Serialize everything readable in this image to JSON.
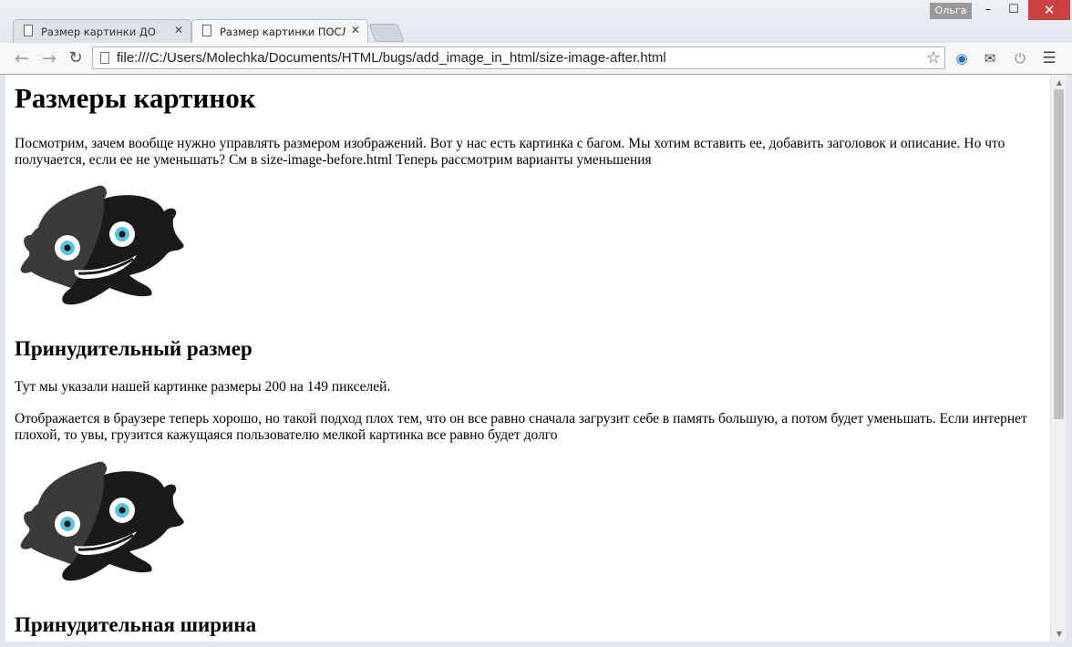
{
  "window": {
    "user_name": "Ольга",
    "minimize_glyph": "–",
    "maximize_glyph": "☐",
    "close_glyph": "✕"
  },
  "tabs": [
    {
      "label": "Размер картинки ДО",
      "close": "✕",
      "active": false
    },
    {
      "label": "Размер картинки ПОСЛЕ",
      "close": "✕",
      "active": true
    }
  ],
  "toolbar": {
    "back_glyph": "←",
    "forward_glyph": "→",
    "reload_glyph": "↻",
    "url": "file:///C:/Users/Molechka/Documents/HTML/bugs/add_image_in_html/size-image-after.html",
    "bookmark_glyph": "☆",
    "icons": [
      "globe-icon",
      "mail-icon",
      "power-icon",
      "menu-icon"
    ]
  },
  "page": {
    "heading": "Размеры картинок",
    "intro": "Посмотрим, зачем вообще нужно управлять размером изображений. Вот у нас есть картинка с багом. Мы хотим вставить ее, добавить заголовок и описание. Но что получается, если ее не уменьшать? См в size-image-before.html Теперь рассмотрим варианты уменьшения",
    "section1_heading": "Принудительный размер",
    "section1_p1": "Тут мы указали нашей картинке размеры 200 на 149 пикселей.",
    "section1_p2": "Отображается в браузере теперь хорошо, но такой подход плох тем, что он все равно сначала загрузит себе в память большую, а потом будет уменьшать. Если интернет плохой, то увы, грузится кажущаяся пользователю мелкой картинка все равно будет долго",
    "section2_heading": "Принудительная ширина"
  },
  "colors": {
    "monster_body": "#1a1a1a",
    "monster_shade": "#3a3a3a",
    "eye_iris": "#5bc4dc",
    "close_button": "#c84040"
  },
  "scrollbar": {
    "up_glyph": "▲",
    "down_glyph": "▼"
  }
}
